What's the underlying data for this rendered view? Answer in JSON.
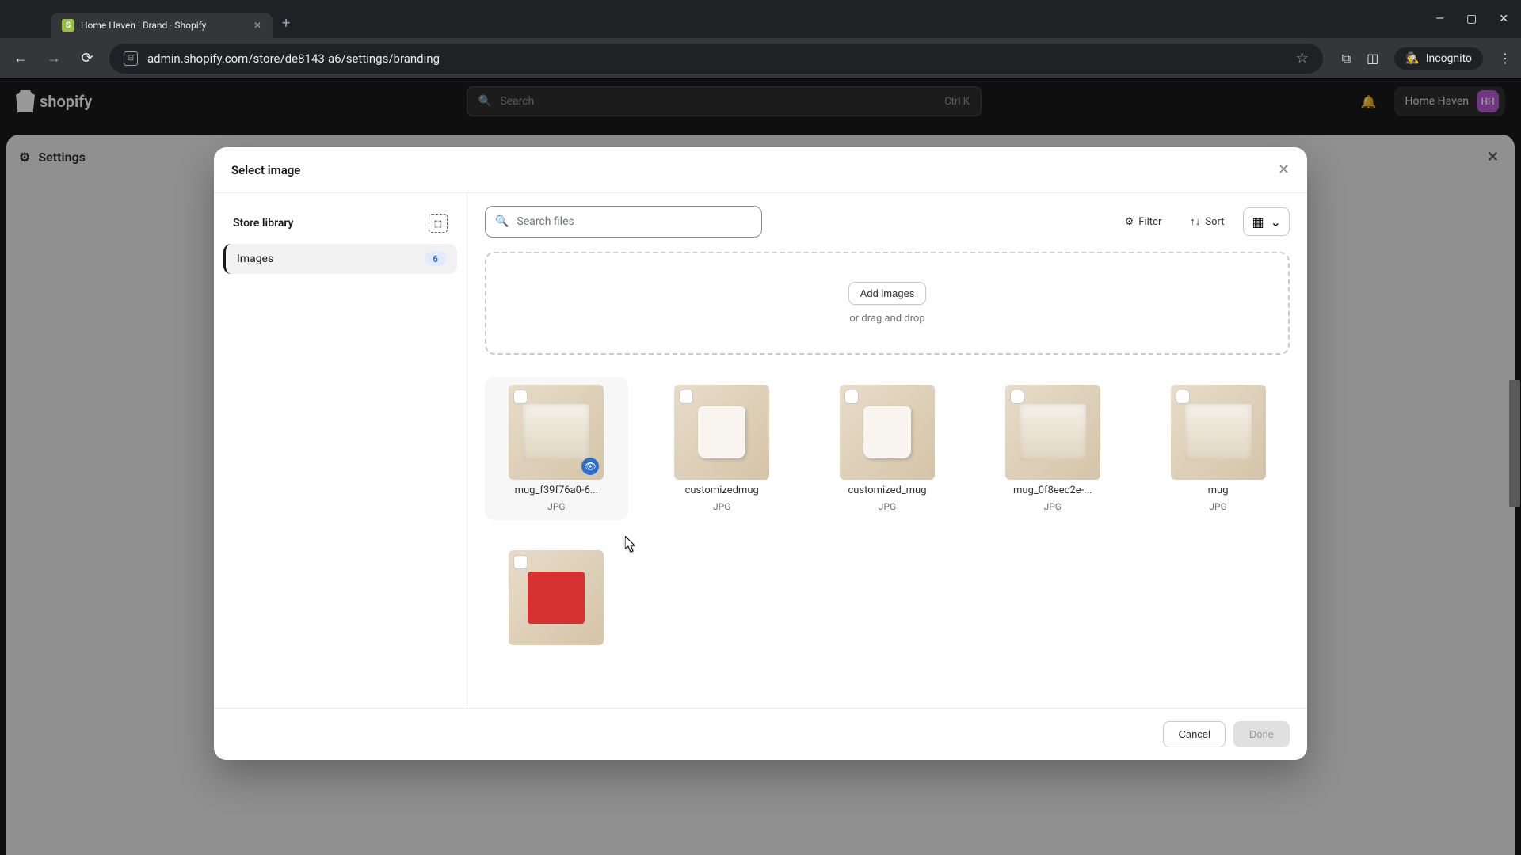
{
  "browser": {
    "tab_title": "Home Haven · Brand · Shopify",
    "url": "admin.shopify.com/store/de8143-a6/settings/branding",
    "incognito_label": "Incognito"
  },
  "shopify": {
    "logo_text": "shopify",
    "search_placeholder": "Search",
    "search_shortcut": "Ctrl K",
    "store_name": "Home Haven",
    "avatar_initials": "HH"
  },
  "settings": {
    "title": "Settings"
  },
  "modal": {
    "title": "Select image",
    "sidebar": {
      "title": "Store library",
      "items": [
        {
          "label": "Images",
          "count": "6"
        }
      ]
    },
    "search_placeholder": "Search files",
    "filter_label": "Filter",
    "sort_label": "Sort",
    "dropzone": {
      "button": "Add images",
      "hint": "or drag and drop"
    },
    "images": [
      {
        "name": "mug_f39f76a0-6...",
        "type": "JPG",
        "kind": "mugs",
        "hover": true,
        "preview": true
      },
      {
        "name": "customizedmug",
        "type": "JPG",
        "kind": "mug-single"
      },
      {
        "name": "customized_mug",
        "type": "JPG",
        "kind": "mug-single"
      },
      {
        "name": "mug_0f8eec2e-...",
        "type": "JPG",
        "kind": "mugs"
      },
      {
        "name": "mug",
        "type": "JPG",
        "kind": "mugs"
      },
      {
        "name": "",
        "type": "",
        "kind": "gift"
      }
    ],
    "footer": {
      "cancel": "Cancel",
      "done": "Done"
    }
  }
}
